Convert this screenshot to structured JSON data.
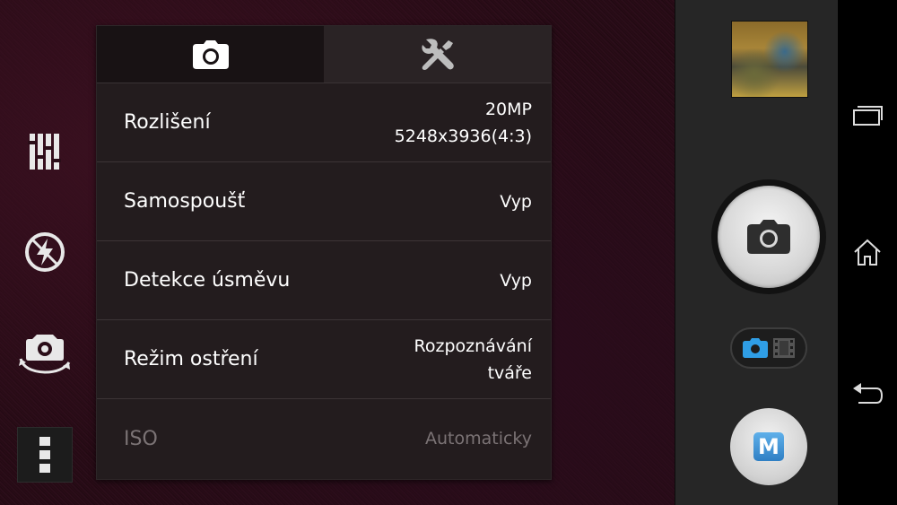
{
  "tabs": [
    {
      "name": "camera-settings",
      "icon": "camera-icon",
      "active": true
    },
    {
      "name": "general-settings",
      "icon": "tools-icon",
      "active": false
    }
  ],
  "settings": [
    {
      "label": "Rozlišení",
      "value_line1": "20MP",
      "value_line2": "5248x3936(4:3)",
      "enabled": true
    },
    {
      "label": "Samospoušť",
      "value_line1": "Vyp",
      "value_line2": "",
      "enabled": true
    },
    {
      "label": "Detekce úsměvu",
      "value_line1": "Vyp",
      "value_line2": "",
      "enabled": true
    },
    {
      "label": "Režim ostření",
      "value_line1": "Rozpoznávání",
      "value_line2": "tváře",
      "enabled": true
    },
    {
      "label": "ISO",
      "value_line1": "Automaticky",
      "value_line2": "",
      "enabled": false
    }
  ],
  "left_toolbar": [
    "sliders-icon",
    "flash-off-icon",
    "switch-camera-icon",
    "more-options-icon"
  ],
  "right_controls": {
    "manual_mode_label": "M",
    "shutter_icon": "camera-icon",
    "mode_toggle_icons": [
      "camera-icon",
      "video-icon"
    ]
  },
  "nav_bar": [
    "recent-apps-icon",
    "home-icon",
    "back-icon"
  ],
  "colors": {
    "accent_blue": "#2f9ee6",
    "panel_bg": "#231c1e",
    "disabled_text": "#7b7375"
  }
}
